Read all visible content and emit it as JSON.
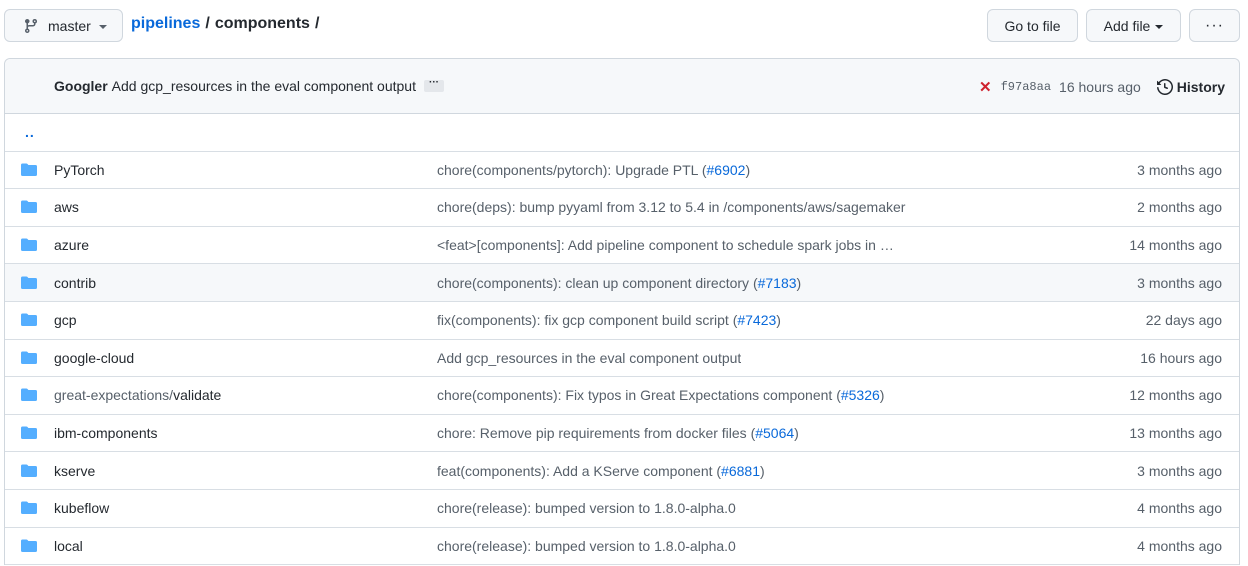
{
  "topbar": {
    "branch": "master",
    "breadcrumb": {
      "repo": "pipelines",
      "separator": "/",
      "current": "components",
      "trailing_separator": "/"
    },
    "buttons": {
      "go_to_file": "Go to file",
      "add_file": "Add file",
      "more": "···"
    }
  },
  "commit": {
    "author": "Googler",
    "message": "Add gcp_resources in the eval component output",
    "ellipsis": "···",
    "status": "failure",
    "status_color": "#cf222e",
    "sha": "f97a8aa",
    "time": "16 hours ago",
    "history_label": "History"
  },
  "updir_label": "..",
  "colors": {
    "link": "#0969da",
    "folder": "#54aeff",
    "muted": "#57606a"
  },
  "rows": [
    {
      "name": "PyTorch",
      "prefix": "",
      "message": "chore(components/pytorch): Upgrade PTL (",
      "pr": "#6902",
      "suffix": ")",
      "age": "3 months ago"
    },
    {
      "name": "aws",
      "prefix": "",
      "message": "chore(deps): bump pyyaml from 3.12 to 5.4 in /components/aws/sagemaker (",
      "pr": "",
      "suffix": "",
      "age": "2 months ago"
    },
    {
      "name": "azure",
      "prefix": "",
      "message": "<feat>[components]: Add pipeline component to schedule spark jobs in …",
      "pr": "",
      "suffix": "",
      "age": "14 months ago"
    },
    {
      "name": "contrib",
      "prefix": "",
      "message": "chore(components): clean up component directory (",
      "pr": "#7183",
      "suffix": ")",
      "age": "3 months ago"
    },
    {
      "name": "gcp",
      "prefix": "",
      "message": "fix(components): fix gcp component build script (",
      "pr": "#7423",
      "suffix": ")",
      "age": "22 days ago"
    },
    {
      "name": "google-cloud",
      "prefix": "",
      "message": "Add gcp_resources in the eval component output",
      "pr": "",
      "suffix": "",
      "age": "16 hours ago"
    },
    {
      "name": "validate",
      "prefix": "great-expectations/",
      "message": "chore(components): Fix typos in Great Expectations component (",
      "pr": "#5326",
      "suffix": ")",
      "age": "12 months ago"
    },
    {
      "name": "ibm-components",
      "prefix": "",
      "message": "chore: Remove pip requirements from docker files (",
      "pr": "#5064",
      "suffix": ")",
      "age": "13 months ago"
    },
    {
      "name": "kserve",
      "prefix": "",
      "message": "feat(components): Add a KServe component (",
      "pr": "#6881",
      "suffix": ")",
      "age": "3 months ago"
    },
    {
      "name": "kubeflow",
      "prefix": "",
      "message": "chore(release): bumped version to 1.8.0-alpha.0",
      "pr": "",
      "suffix": "",
      "age": "4 months ago"
    },
    {
      "name": "local",
      "prefix": "",
      "message": "chore(release): bumped version to 1.8.0-alpha.0",
      "pr": "",
      "suffix": "",
      "age": "4 months ago"
    }
  ]
}
